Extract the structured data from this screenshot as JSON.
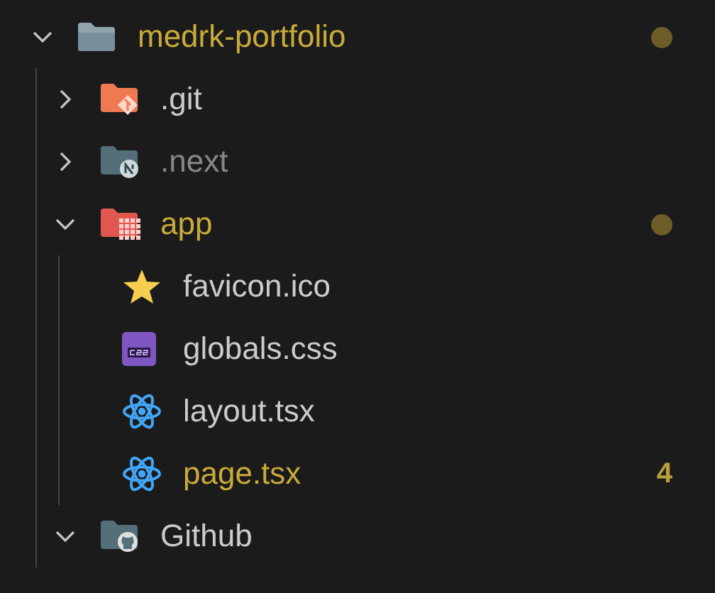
{
  "tree": [
    {
      "label": "medrk-portfolio",
      "kind": "folder",
      "expanded": true,
      "modified": true,
      "ignored": false,
      "children": [
        {
          "label": ".git",
          "kind": "gitfolder",
          "expanded": false,
          "modified": false,
          "ignored": false
        },
        {
          "label": ".next",
          "kind": "nextfolder",
          "expanded": false,
          "modified": false,
          "ignored": true
        },
        {
          "label": "app",
          "kind": "appfolder",
          "expanded": true,
          "modified": true,
          "ignored": false,
          "children": [
            {
              "label": "favicon.ico",
              "kind": "star",
              "modified": false,
              "ignored": false
            },
            {
              "label": "globals.css",
              "kind": "css",
              "modified": false,
              "ignored": false
            },
            {
              "label": "layout.tsx",
              "kind": "react",
              "modified": false,
              "ignored": false
            },
            {
              "label": "page.tsx",
              "kind": "react",
              "modified": true,
              "ignored": false,
              "badge": "4"
            }
          ]
        },
        {
          "label": "Github",
          "kind": "githubfolder",
          "expanded": true,
          "modified": false,
          "ignored": false
        }
      ]
    }
  ]
}
